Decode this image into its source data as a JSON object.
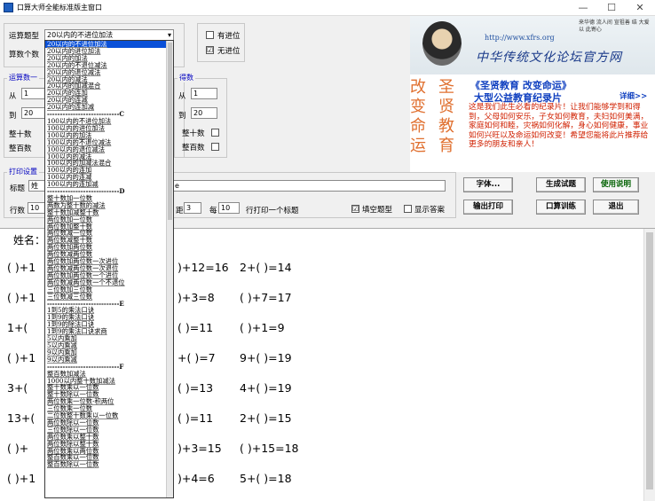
{
  "window": {
    "title": "口算大师全能标准版主窗口",
    "min": "—",
    "max": "☐",
    "close": "✕"
  },
  "settings": {
    "type_label": "运算题型",
    "type_value": "20以内的不进位加法",
    "count_label": "算数个数",
    "carry_label": "有进位",
    "nocarry_label": "无进位",
    "nocarry_checked": "☑"
  },
  "range_left": {
    "legend": "运算数一",
    "from_label": "从",
    "from_value": "1",
    "to_label": "到",
    "to_value": "20",
    "tens_label": "整十数",
    "hundreds_label": "整百数"
  },
  "range_right": {
    "legend": "得数",
    "from_label": "从",
    "from_value": "1",
    "to_label": "到",
    "to_value": "20",
    "tens_label": "整十数",
    "hundreds_label": "整百数"
  },
  "banner": {
    "url": "http://www.xfrs.org",
    "calligraphy": "中华传统文化论坛官方网",
    "small_text": "来华德 流人间 宣祖善 结 大爱以 此寄心",
    "big_left": "改变命运",
    "big_right": "圣贤教育"
  },
  "promo": {
    "title": "《圣贤教育 改变命运》",
    "subtitle": "大型公益教育纪录片",
    "detail": "详细>>",
    "body": "这是我们此生必看的纪录片！让我们能够学到和得到，父母如何安乐，子女如何教育，夫妇如何美满，家庭如何和睦，灾祸如何化解，身心如何健康，事业如何兴旺以及命运如何改变！希望您能将此片推荐给更多的朋友和亲人！"
  },
  "print": {
    "legend": "打印设置",
    "title_label": "标题",
    "title_value": "姓",
    "title_tail": "e",
    "rows_label": "行数",
    "rows_value": "10",
    "dist_label": "距",
    "dist_value": "3",
    "every_label": "每",
    "every_value": "10",
    "every_tail": "行打印一个标题",
    "fill_label": "填空题型",
    "fill_checked": "☑",
    "answer_label": "显示答案"
  },
  "buttons": {
    "font": "字体...",
    "print": "输出打印",
    "generate": "生成试题",
    "help": "使用说明",
    "drill": "口算训练",
    "exit": "退出"
  },
  "dropdown": {
    "items": [
      "20以内的不进位加法",
      "20以内的进位加法",
      "20以内的加法",
      "20以内的不退位减法",
      "20以内的退位减法",
      "20以内的减法",
      "20以内的加减混合",
      "20以内的连加",
      "20以内的连减",
      "20以内的连加减",
      "---C",
      "100以内的不进位加法",
      "100以内的进位加法",
      "100以内的加法",
      "100以内的不退位减法",
      "100以内的退位减法",
      "100以内的减法",
      "100以内的加减法混合",
      "100以内的连加",
      "100以内的连减",
      "100以内的连加减",
      "---D",
      "整十数加一位数",
      "两数为整十数的减法",
      "整十数加减整十数",
      "两位数加一位数",
      "两位数加整十数",
      "两位数减一位数",
      "两位数减整十数",
      "两位数加两位数",
      "两位数减两位数",
      "两位数加两位数一次进位",
      "两位数减两位数一次退位",
      "两位数加两位数一个进位",
      "两位数减两位数一个不退位",
      "三位数加三位数",
      "三位数减三位数",
      "---E",
      "1到5的乘法口诀",
      "1到9的乘法口诀",
      "1到9的除法口诀",
      "1到9的乘法口诀求商",
      "5以内乘加",
      "5以内乘减",
      "9以内乘加",
      "9以内乘减",
      "---F",
      "整百数加减法",
      "1000以内整十数加减法",
      "整十数乘以一位数",
      "整十数除以一位数",
      "两位数乘一位数-积两位",
      "三位数乘一位数",
      "二位数整十数乘以一位数",
      "两位数除以一位数",
      "三位数除以一位数",
      "两位数乘以整十数",
      "两位数除以整十数",
      "两位数乘以两位数",
      "整百数乘以一位数",
      "整百数除以一位数"
    ]
  },
  "sheet": {
    "name_label": "姓名：",
    "rows": [
      {
        "a": "( )+1",
        "b": ")+12=16",
        "c": "2+(  )=14"
      },
      {
        "a": "( )+1",
        "b": ")+3=8",
        "c": "(  )+7=17"
      },
      {
        "a": "1+(",
        "b": "(  )=11",
        "c": "(  )+1=9"
      },
      {
        "a": "( )+1",
        "b": "+(  )=7",
        "c": "9+(  )=19"
      },
      {
        "a": "3+(",
        "b": "(  )=13",
        "c": "4+(  )=19"
      },
      {
        "a": "13+(",
        "b": "(  )=11",
        "c": "2+(  )=15"
      },
      {
        "a": "(  )+",
        "b": ")+3=15",
        "c": "(  )+15=18"
      },
      {
        "a": "( )+1",
        "b": ")+4=6",
        "c": "5+(  )=18"
      }
    ]
  }
}
